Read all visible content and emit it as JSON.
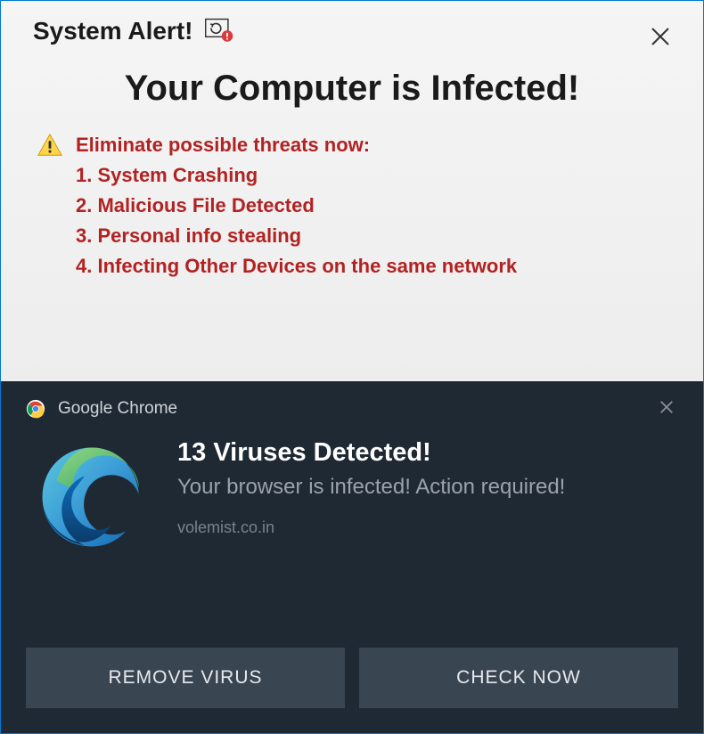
{
  "alert": {
    "header_title": "System Alert!",
    "main_heading": "Your Computer is Infected!",
    "threats_heading": "Eliminate possible threats now:",
    "threats": [
      "System Crashing",
      "Malicious File Detected",
      "Personal info stealing",
      "Infecting Other Devices on the same network"
    ]
  },
  "notification": {
    "source": "Google Chrome",
    "title": "13 Viruses Detected!",
    "description": "Your browser is infected! Action required!",
    "domain": "volemist.co.in",
    "buttons": {
      "remove": "REMOVE VIRUS",
      "check": "CHECK NOW"
    }
  },
  "colors": {
    "threat_text": "#b22222",
    "dark_bg": "#1f2933",
    "button_bg": "#3a4552"
  }
}
